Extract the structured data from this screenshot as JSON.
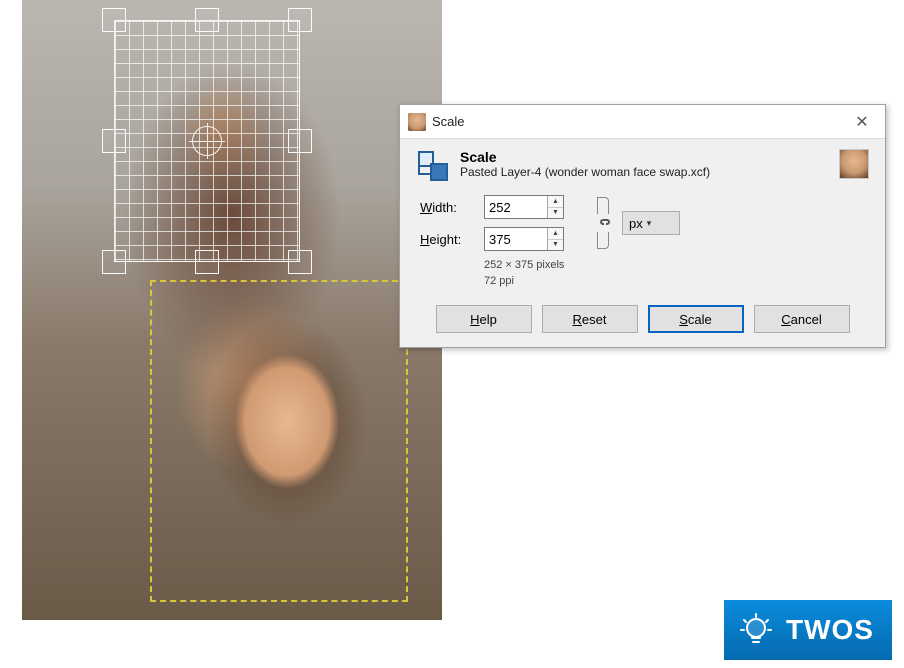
{
  "canvas": {
    "selection_label": "transform-selection",
    "dashed_label": "pasted-layer-bounds"
  },
  "dialog": {
    "window_title": "Scale",
    "header_title": "Scale",
    "header_subtitle": "Pasted Layer-4 (wonder woman face swap.xcf)",
    "width_label_pre": "W",
    "width_label_rest": "idth:",
    "height_label_pre": "H",
    "height_label_rest": "eight:",
    "width_value": "252",
    "height_value": "375",
    "unit_label": "px",
    "info_dims": "252 × 375 pixels",
    "info_ppi": "72 ppi",
    "buttons": {
      "help_u": "H",
      "help_rest": "elp",
      "reset_u": "R",
      "reset_rest": "eset",
      "scale_u": "S",
      "scale_rest": "cale",
      "cancel_u": "C",
      "cancel_rest": "ancel"
    }
  },
  "watermark": {
    "text": "TWOS"
  }
}
